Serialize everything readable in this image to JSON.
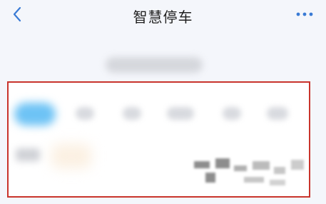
{
  "nav": {
    "title": "智慧停车",
    "back_icon": "chevron-left-icon",
    "more_icon": "more-dots-icon"
  },
  "colors": {
    "accent": "#3a7bd5",
    "highlight_border": "#c9342c",
    "active_tab": "#6ec3f5"
  },
  "tabs_count": 6
}
